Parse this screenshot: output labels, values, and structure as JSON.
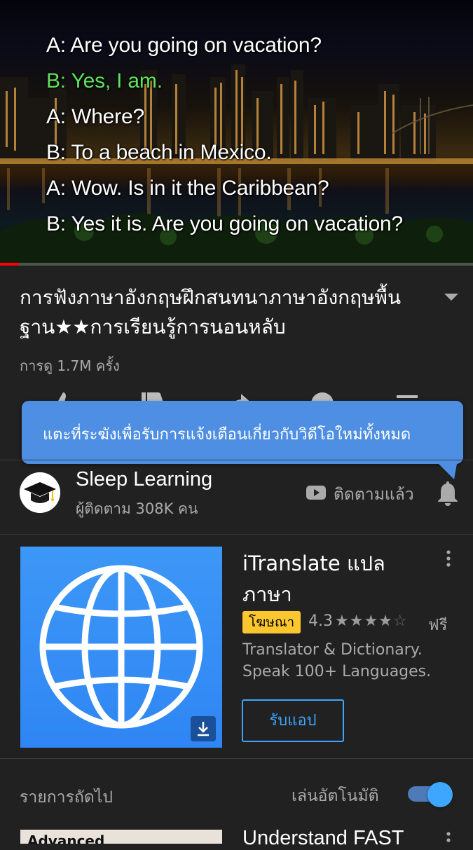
{
  "player": {
    "subtitle_lines": [
      {
        "text": "A: Are you going on vacation?",
        "highlight": false
      },
      {
        "text": "B: Yes, I am.",
        "highlight": true
      },
      {
        "text": "A: Where?",
        "highlight": false
      },
      {
        "text": "B: To a beach in Mexico.",
        "highlight": false
      },
      {
        "text": "A: Wow. Is in it the Caribbean?",
        "highlight": false
      },
      {
        "text": "B: Yes it is. Are you going on vacation?",
        "highlight": false
      }
    ],
    "highlight_color": "#5fe25a",
    "progress_fraction": 0.04,
    "progress_color": "#ff0000"
  },
  "video": {
    "title": "การฟังภาษาอังกฤษฝึกสนทนาภาษาอังกฤษพื้นฐาน★★การเรียนรู้การนอนหลับ",
    "views": "การดู 1.7M ครั้ง"
  },
  "tooltip": {
    "text": "แตะที่ระฆังเพื่อรับการแจ้งเตือนเกี่ยวกับวิดีโอใหม่ทั้งหมด",
    "color": "#4e8fe3"
  },
  "channel": {
    "name": "Sleep Learning",
    "subscribers": "ผู้ติดตาม 308K คน",
    "subscribed_label": "ติดตามแล้ว"
  },
  "ad": {
    "title": "iTranslate แปลภาษา",
    "badge": "โฆษณา",
    "rating": "4.3",
    "stars_value": 4.3,
    "price": "ฟรี",
    "description": "Translator & Dictionary. Speak 100+ Languages.",
    "cta": "รับแอป",
    "accent_color": "#3ea6ff",
    "badge_color": "#fbc62e"
  },
  "up_next": {
    "label": "รายการถัดไป",
    "autoplay_label": "เล่นอัตโนมัติ",
    "autoplay_on": true,
    "next_title": "Understand FAST",
    "next_thumb_text": "Advanced"
  }
}
